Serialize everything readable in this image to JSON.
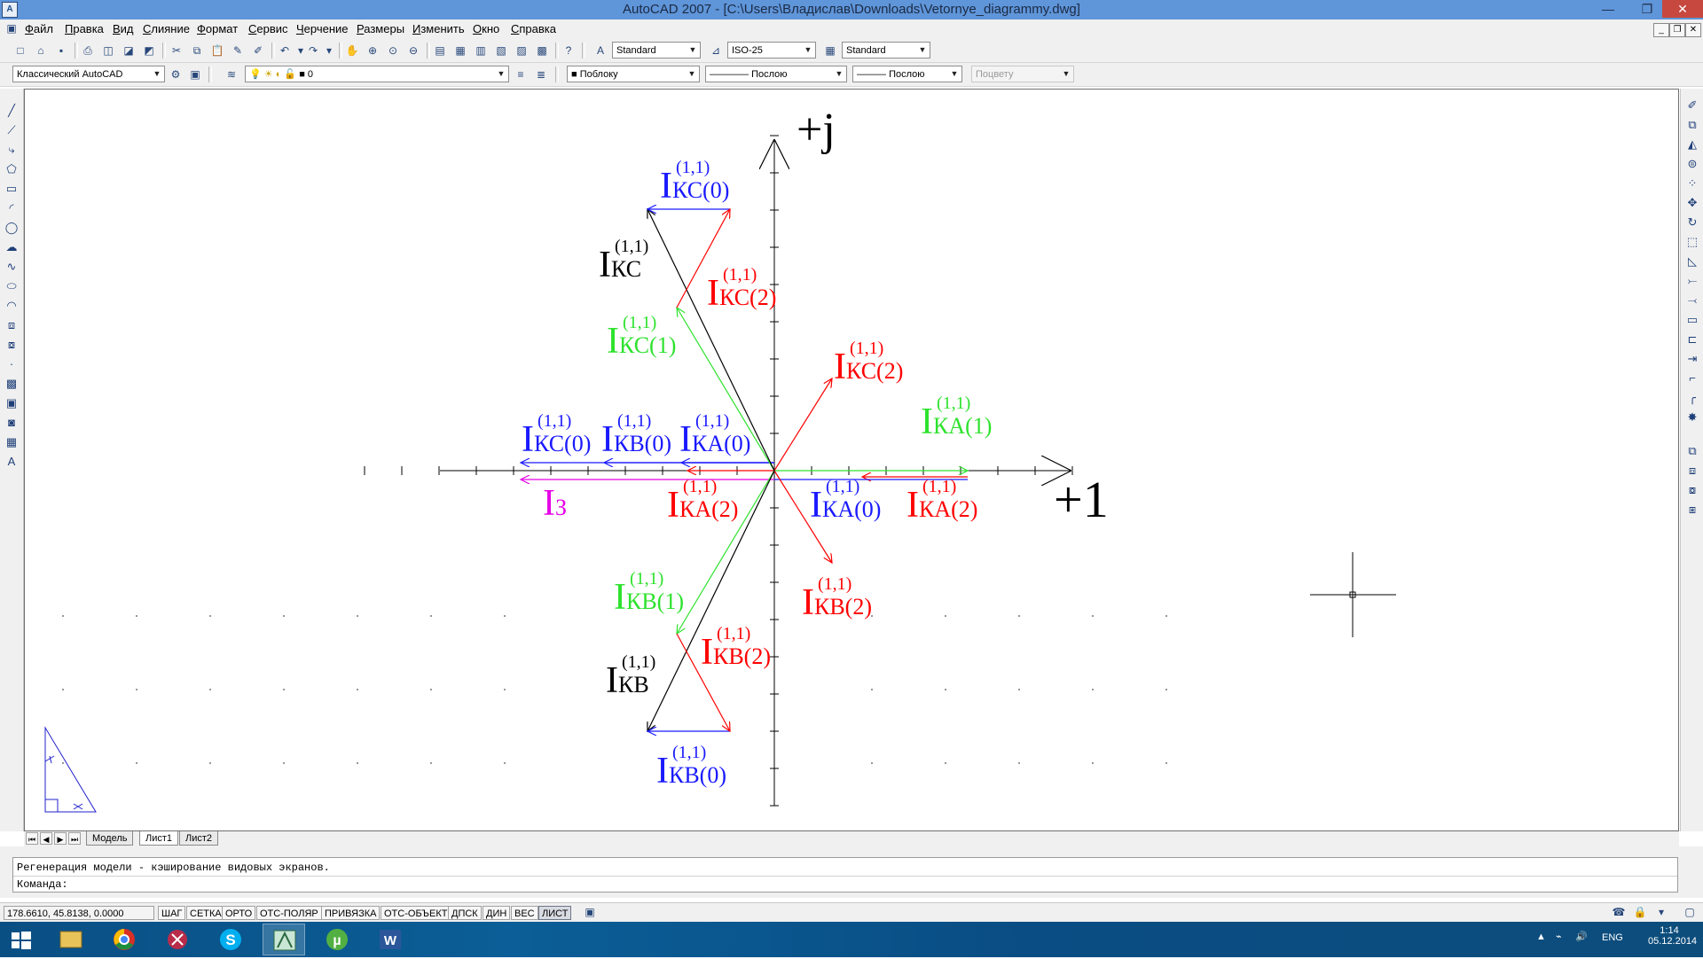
{
  "window": {
    "title": "AutoCAD 2007 - [C:\\Users\\Владислав\\Downloads\\Vetornye_diagrammy.dwg]",
    "minimize_glyph": "—",
    "restore_glyph": "❐",
    "close_glyph": "✕",
    "app_icon_label": "A"
  },
  "menu": {
    "items": [
      "Файл",
      "Правка",
      "Вид",
      "Слияние",
      "Формат",
      "Сервис",
      "Черчение",
      "Размеры",
      "Изменить",
      "Окно",
      "Справка"
    ]
  },
  "toolbar_standard": {
    "text_style": "Standard",
    "dim_style": "ISO-25",
    "table_style": "Standard"
  },
  "toolbar_layers": {
    "workspace": "Классический AutoCAD",
    "layer": "0",
    "color": "Поблоку",
    "linetype": "Послою",
    "lineweight": "Послою",
    "plot_style": "Поцвету"
  },
  "drawing": {
    "axis_x_label": "+1",
    "axis_y_label": "+j",
    "superscript": "(1,1)",
    "colors": {
      "blue": "#1a1aff",
      "red": "#ff0000",
      "green": "#2de22d",
      "black": "#000000",
      "magenta": "#e600e6"
    },
    "labels": [
      {
        "id": "ikc0-top",
        "main": "I",
        "sub": "КС(0)",
        "color": "blue"
      },
      {
        "id": "ikc-black-top",
        "main": "I",
        "sub": "КС",
        "color": "black"
      },
      {
        "id": "ikc2-top",
        "main": "I",
        "sub": "КС(2)",
        "color": "red"
      },
      {
        "id": "ikc1",
        "main": "I",
        "sub": "КС(1)",
        "color": "green"
      },
      {
        "id": "ikc2-right",
        "main": "I",
        "sub": "КС(2)",
        "color": "red"
      },
      {
        "id": "ika1",
        "main": "I",
        "sub": "КА(1)",
        "color": "green"
      },
      {
        "id": "ikc0-left",
        "main": "I",
        "sub": "КС(0)",
        "color": "blue"
      },
      {
        "id": "ikb0-left",
        "main": "I",
        "sub": "КВ(0)",
        "color": "blue"
      },
      {
        "id": "ika0-left",
        "main": "I",
        "sub": "КА(0)",
        "color": "blue"
      },
      {
        "id": "i3",
        "main": "I",
        "sub": "З",
        "color": "magenta"
      },
      {
        "id": "ika2-left",
        "main": "I",
        "sub": "КА(2)",
        "color": "red"
      },
      {
        "id": "ika0-right",
        "main": "I",
        "sub": "КА(0)",
        "color": "blue"
      },
      {
        "id": "ika2-right",
        "main": "I",
        "sub": "КА(2)",
        "color": "red"
      },
      {
        "id": "ikb2-right",
        "main": "I",
        "sub": "КВ(2)",
        "color": "red"
      },
      {
        "id": "ikb1",
        "main": "I",
        "sub": "КВ(1)",
        "color": "green"
      },
      {
        "id": "ikb2-bottom",
        "main": "I",
        "sub": "КВ(2)",
        "color": "red"
      },
      {
        "id": "ikb-black",
        "main": "I",
        "sub": "КВ",
        "color": "black"
      },
      {
        "id": "ikb0-bottom",
        "main": "I",
        "sub": "КВ(0)",
        "color": "blue"
      }
    ]
  },
  "layout_tabs": {
    "tabs": [
      "Модель",
      "Лист1",
      "Лист2"
    ],
    "active": "Лист1"
  },
  "command": {
    "history": "Регенерация модели - кэширование видовых экранов.",
    "prompt": "Команда:"
  },
  "status": {
    "coords": "178.6610, 45.8138, 0.0000",
    "buttons": [
      "ШАГ",
      "СЕТКА",
      "ОРТО",
      "ОТС-ПОЛЯР",
      "ПРИВЯЗКА",
      "ОТС-ОБЪЕКТ",
      "ДПСК",
      "ДИН",
      "ВЕС",
      "ЛИСТ"
    ]
  },
  "taskbar": {
    "lang": "ENG",
    "time": "1:14",
    "date": "05.12.2014",
    "word_label": "W"
  }
}
